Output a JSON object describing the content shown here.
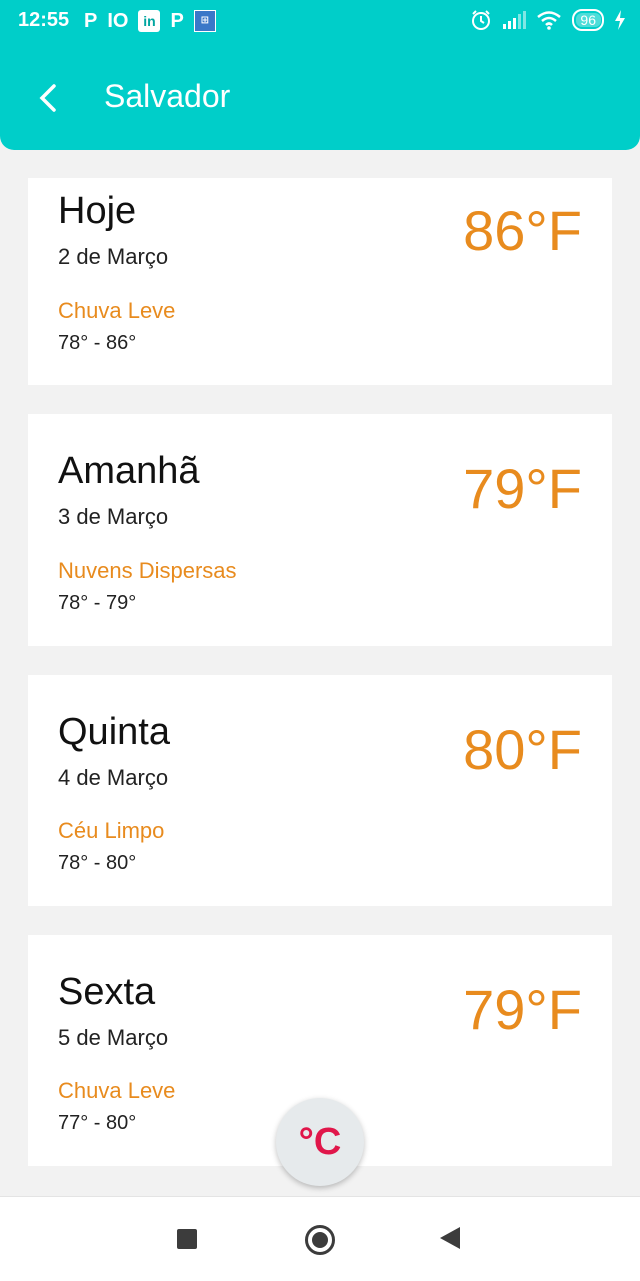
{
  "status": {
    "time": "12:55",
    "apps": [
      "P",
      "IO",
      "in",
      "P",
      "⊞"
    ],
    "battery": "96"
  },
  "header": {
    "title": "Salvador"
  },
  "forecast": [
    {
      "day": "Hoje",
      "date": "2 de Março",
      "condition": "Chuva Leve",
      "range": "78° - 86°",
      "temp": "86°F"
    },
    {
      "day": "Amanhã",
      "date": "3 de Março",
      "condition": "Nuvens Dispersas",
      "range": "78° - 79°",
      "temp": "79°F"
    },
    {
      "day": "Quinta",
      "date": "4 de Março",
      "condition": "Céu Limpo",
      "range": "78° - 80°",
      "temp": "80°F"
    },
    {
      "day": "Sexta",
      "date": "5 de Março",
      "condition": "Chuva Leve",
      "range": "77° - 80°",
      "temp": "79°F"
    }
  ],
  "fab": {
    "label": "°C"
  },
  "colors": {
    "header": "#00cec9",
    "accent": "#e88b1e",
    "fab_text": "#e0164a"
  },
  "icons": [
    "back-arrow-icon",
    "alarm-icon",
    "signal-icon",
    "wifi-icon",
    "battery-icon",
    "charging-icon"
  ]
}
